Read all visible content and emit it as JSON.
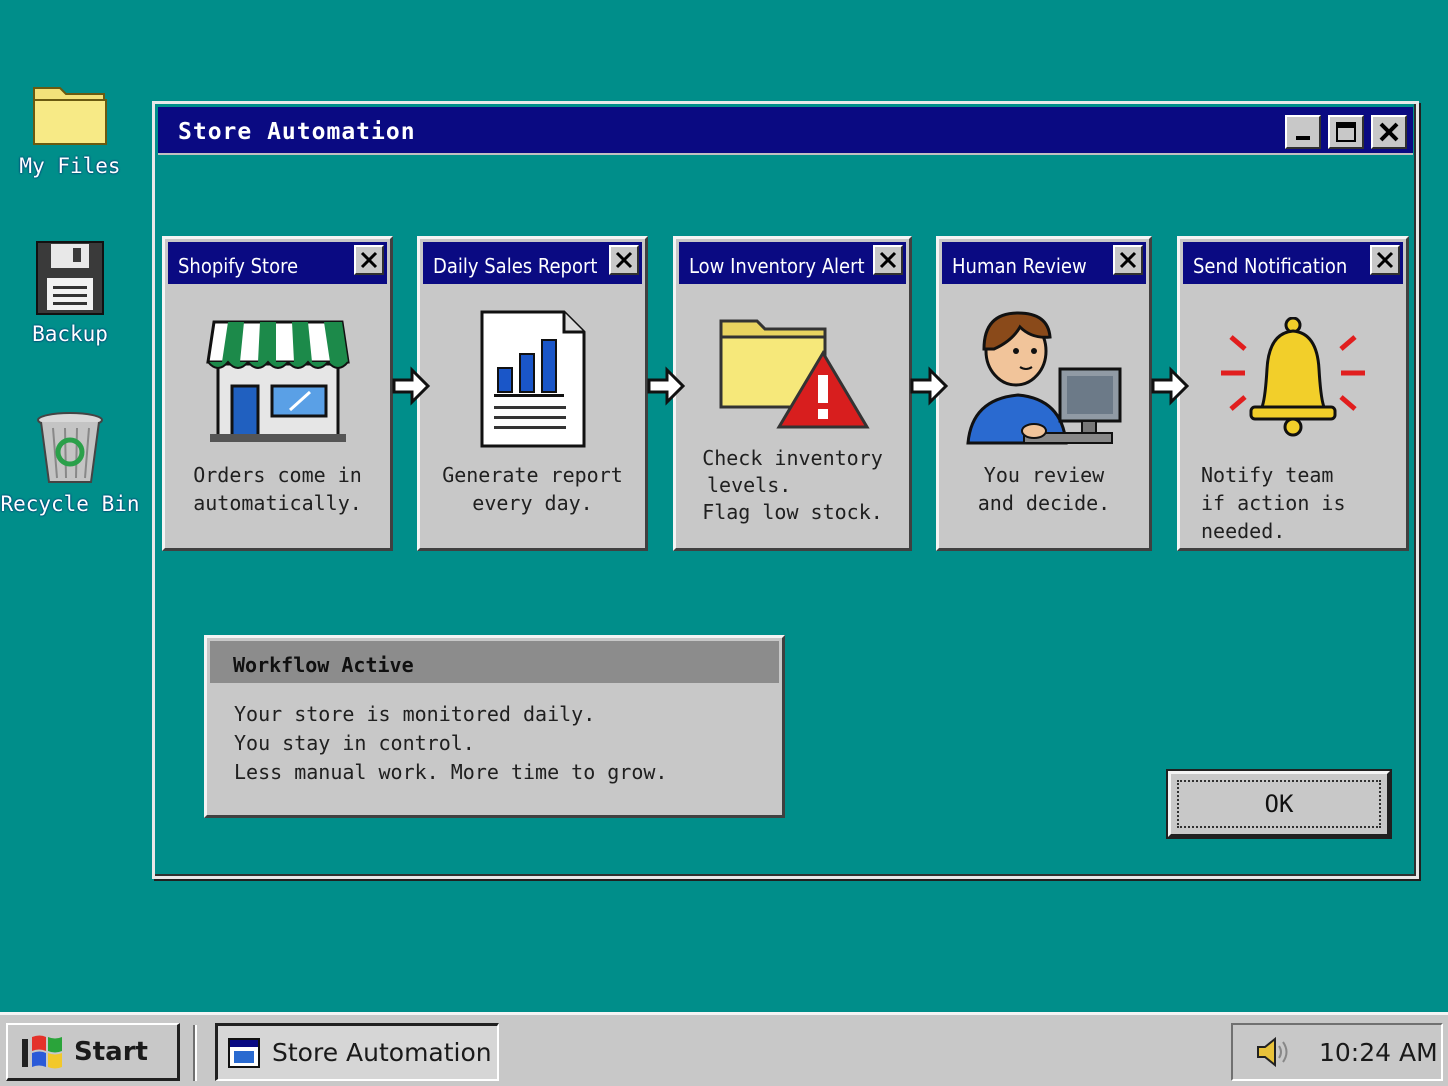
{
  "desktop": {
    "icons": [
      {
        "label": "My Files"
      },
      {
        "label": "Backup"
      },
      {
        "label": "Recycle Bin"
      }
    ]
  },
  "window": {
    "title": "Store Automation",
    "controls": {
      "minimize": "minimize",
      "maximize": "maximize",
      "close": "close"
    }
  },
  "steps": [
    {
      "title": "Shopify Store",
      "lines": [
        "Orders come in",
        "automatically."
      ],
      "icon": "storefront-icon"
    },
    {
      "title": "Daily Sales Report",
      "lines": [
        "Generate report",
        "every day."
      ],
      "icon": "report-chart-icon"
    },
    {
      "title": "Low Inventory Alert",
      "lines": [
        "Check inventory",
        "levels.",
        "Flag low stock."
      ],
      "icon": "folder-warning-icon"
    },
    {
      "title": "Human Review",
      "lines": [
        "You review",
        "and decide."
      ],
      "icon": "person-computer-icon"
    },
    {
      "title": "Send Notification",
      "lines": [
        "Notify team",
        "if action is needed."
      ],
      "icon": "bell-icon"
    }
  ],
  "status": {
    "title": "Workflow Active",
    "lines": [
      "Your store is monitored daily.",
      "You stay in control.",
      "Less manual work. More time to grow."
    ]
  },
  "ok_label": "OK",
  "taskbar": {
    "start_label": "Start",
    "task_label": "Store Automation",
    "clock": "10:24 AM"
  },
  "colors": {
    "desktop": "#008e8a",
    "titlebar": "#0a0a82",
    "panel": "#c8c8c8",
    "alert_red": "#d81e1e",
    "bell_yellow": "#f2cf2a"
  }
}
